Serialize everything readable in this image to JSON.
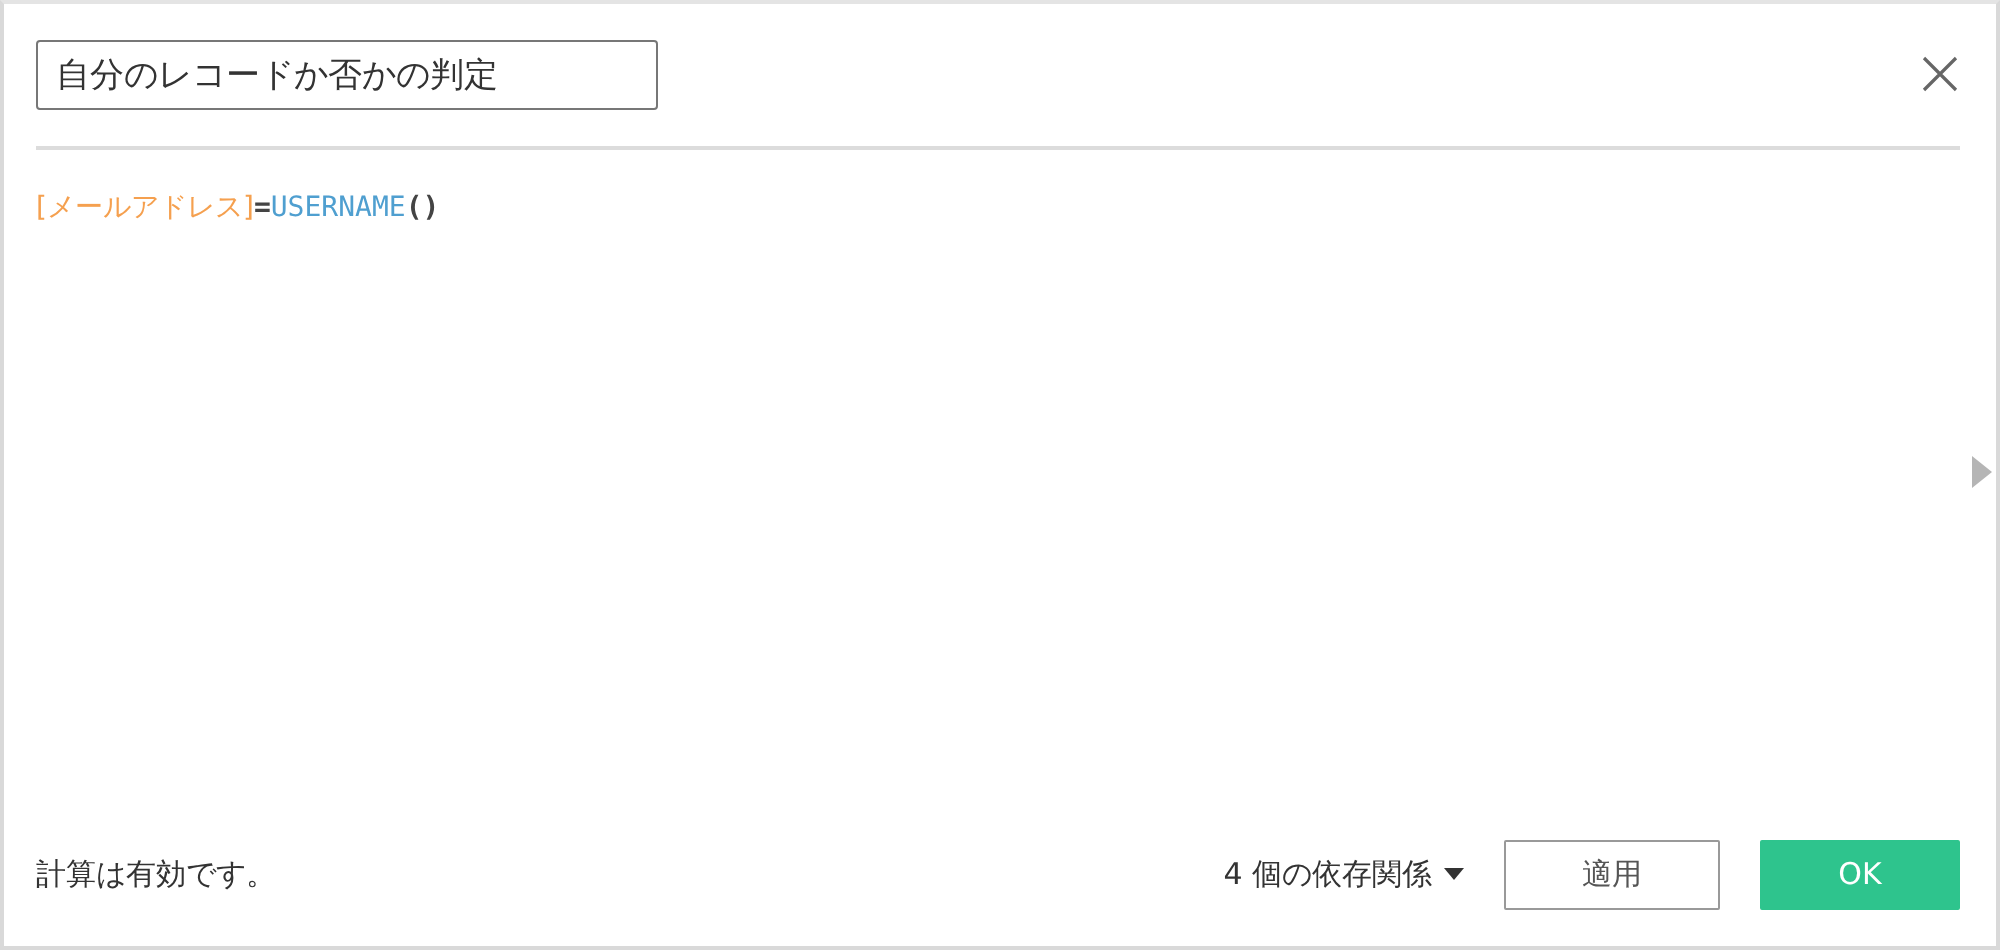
{
  "title_field": {
    "value": "自分のレコードか否かの判定"
  },
  "formula": [
    {
      "kind": "field",
      "text": "[メールアドレス]"
    },
    {
      "kind": "operator",
      "text": "="
    },
    {
      "kind": "function",
      "text": "USERNAME"
    },
    {
      "kind": "paren",
      "text": "()"
    }
  ],
  "status": "計算は有効です。",
  "dependencies": "4 個の依存関係",
  "buttons": [
    {
      "kind": "secondary",
      "label": "適用"
    },
    {
      "kind": "primary",
      "label": "OK"
    }
  ]
}
